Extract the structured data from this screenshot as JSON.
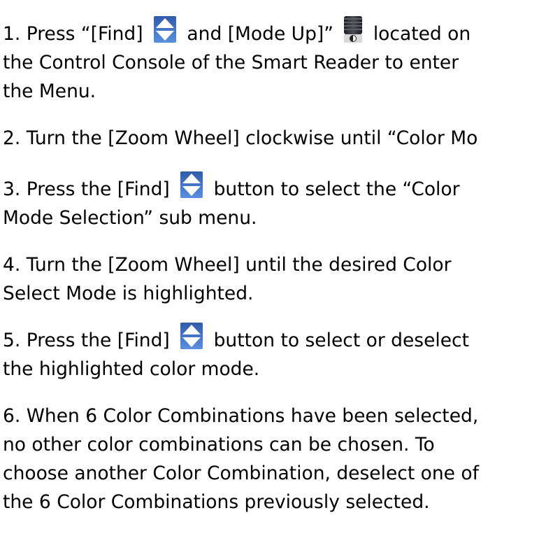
{
  "document": {
    "steps": [
      {
        "a": "1. Press “[Find] ",
        "b": " and [Mode Up]” ",
        "c": " located on",
        "line2": "the Control Console of the Smart Reader to enter",
        "line3": "the Menu."
      },
      {
        "a": "2. Turn the [Zoom Wheel] clockwise until “Color Mo"
      },
      {
        "a": "3. Press the [Find] ",
        "b": " button to select the “Color",
        "line2": "Mode Selection” sub menu."
      },
      {
        "a": "4. Turn the [Zoom Wheel] until the desired Color",
        "line2": "Select Mode is highlighted."
      },
      {
        "a": "5. Press the [Find] ",
        "b": " button to select or deselect",
        "line2": "the highlighted color mode."
      },
      {
        "a": "6. When 6 Color Combinations have been selected,",
        "line2": "no other color combinations can be chosen. To",
        "line3": "choose another Color Combination, deselect one of",
        "line4": "the 6 Color Combinations previously selected."
      }
    ],
    "icons": {
      "find": "find-button-icon",
      "mode_up": "mode-up-button-icon"
    },
    "colors": {
      "find_icon_fill": "#3a72c9",
      "mode_up_body": "#2b2d33"
    }
  }
}
